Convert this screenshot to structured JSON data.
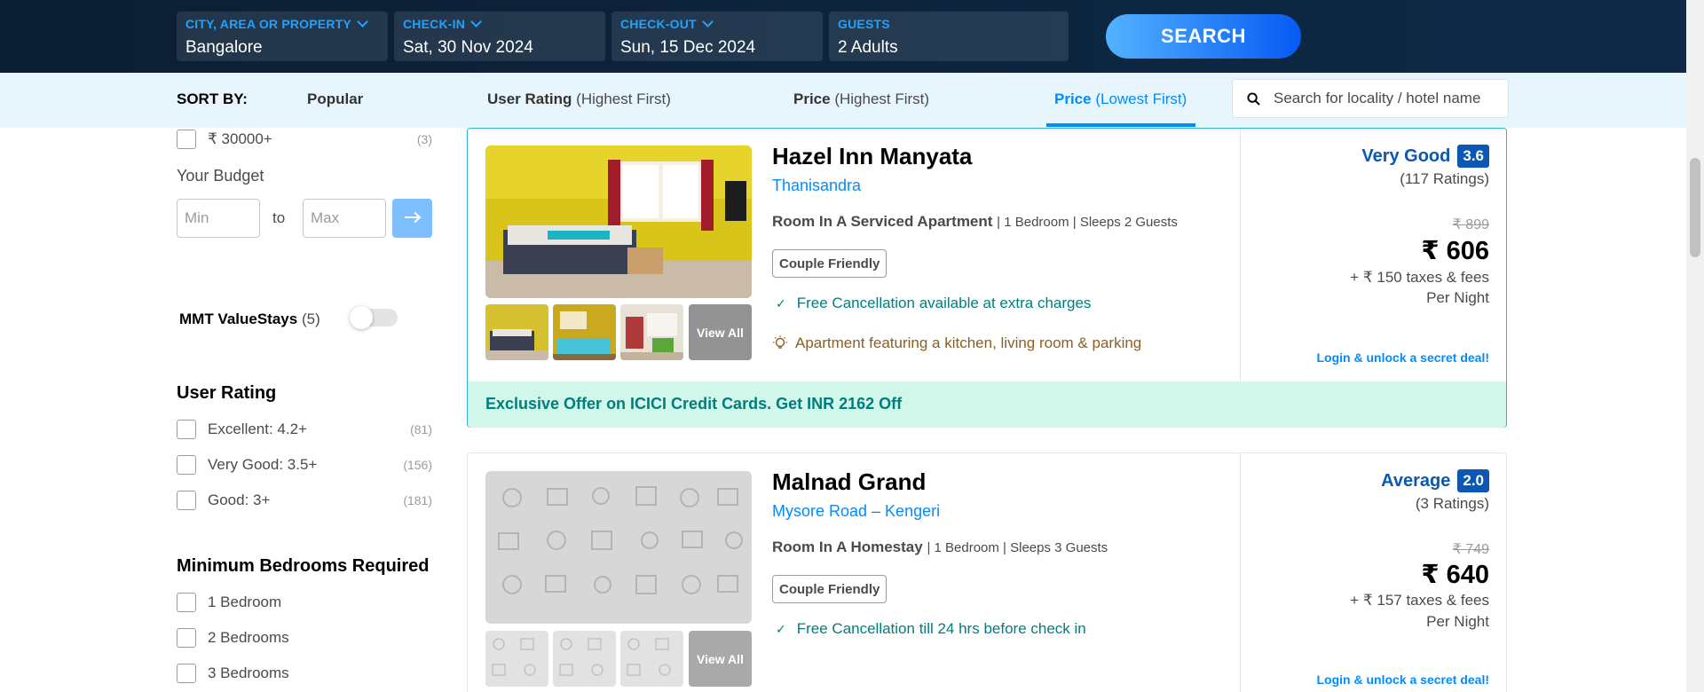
{
  "search": {
    "city": {
      "label": "CITY, AREA OR PROPERTY",
      "value": "Bangalore"
    },
    "checkin": {
      "label": "CHECK-IN",
      "value": "Sat, 30 Nov 2024"
    },
    "checkout": {
      "label": "CHECK-OUT",
      "value": "Sun, 15 Dec 2024"
    },
    "guests": {
      "label": "GUESTS",
      "value": "2 Adults"
    },
    "button": "SEARCH"
  },
  "sort": {
    "label": "SORT BY:",
    "options": [
      {
        "main": "Popular",
        "sub": ""
      },
      {
        "main": "User Rating",
        "sub": "(Highest First)"
      },
      {
        "main": "Price",
        "sub": "(Highest First)"
      },
      {
        "main": "Price",
        "sub": "(Lowest First)"
      }
    ],
    "active": "Price (Lowest First)",
    "search_placeholder": "Search for locality / hotel name"
  },
  "sidebar": {
    "price_item": {
      "label": "₹ 30000+",
      "count": "(3)"
    },
    "budget": {
      "title": "Your Budget",
      "min_placeholder": "Min",
      "to": "to",
      "max_placeholder": "Max"
    },
    "mmt": {
      "label": "MMT ValueStays",
      "count": "(5)",
      "enabled": false
    },
    "user_rating": {
      "title": "User Rating",
      "items": [
        {
          "label": "Excellent: 4.2+",
          "count": "(81)"
        },
        {
          "label": "Very Good: 3.5+",
          "count": "(156)"
        },
        {
          "label": "Good: 3+",
          "count": "(181)"
        }
      ]
    },
    "bedrooms": {
      "title": "Minimum Bedrooms Required",
      "items": [
        {
          "label": "1 Bedroom"
        },
        {
          "label": "2 Bedrooms"
        },
        {
          "label": "3 Bedrooms"
        }
      ]
    }
  },
  "hotels": [
    {
      "name": "Hazel Inn Manyata",
      "location": "Thanisandra",
      "room": "Room In A Serviced Apartment",
      "room_details": "| 1 Bedroom | Sleeps 2 Guests",
      "tag": "Couple Friendly",
      "feature": "Free Cancellation available at extra charges",
      "highlight": "Apartment featuring a kitchen, living room & parking",
      "rating_text": "Very Good",
      "rating": "3.6",
      "rating_count": "(117 Ratings)",
      "original_price": "₹ 899",
      "price": "₹ 606",
      "taxes": "+ ₹ 150 taxes & fees",
      "per_night": "Per Night",
      "login": "Login & unlock a secret deal!",
      "view_all": "View All",
      "offer": "Exclusive Offer on ICICI Credit Cards. Get INR 2162 Off"
    },
    {
      "name": "Malnad Grand",
      "location": "Mysore Road – Kengeri",
      "room": "Room In A Homestay",
      "room_details": "| 1 Bedroom | Sleeps 3 Guests",
      "tag": "Couple Friendly",
      "feature": "Free Cancellation till 24 hrs before check in",
      "rating_text": "Average",
      "rating": "2.0",
      "rating_count": "(3 Ratings)",
      "original_price": "₹ 749",
      "price": "₹ 640",
      "taxes": "+ ₹ 157 taxes & fees",
      "per_night": "Per Night",
      "login": "Login & unlock a secret deal!",
      "view_all": "View All"
    }
  ],
  "colors": {
    "accent": "#008cff",
    "header_bg": "#0b1e33",
    "rating_blue": "#0b58b4",
    "teal": "#007e7d",
    "offer_bg": "#d1f6ea"
  }
}
